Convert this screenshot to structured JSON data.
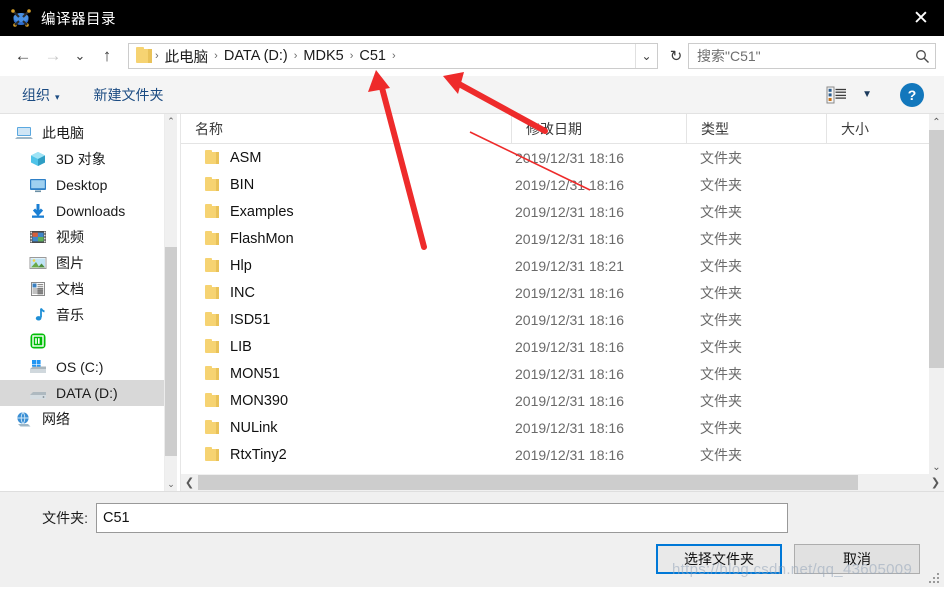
{
  "window": {
    "title": "编译器目录",
    "icon": "keil-uvision-icon",
    "close_label": "✕"
  },
  "nav": {
    "back_label": "←",
    "forward_label": "→",
    "recent_label": "⌄",
    "up_label": "↑",
    "breadcrumb": [
      "此电脑",
      "DATA (D:)",
      "MDK5",
      "C51"
    ],
    "breadcrumb_separator": "›",
    "breadcrumb_trailing_separator": "›",
    "dropdown_label": "⌄",
    "refresh_label": "↻",
    "search_placeholder": "搜索\"C51\"",
    "search_value": "",
    "search_icon": "🔍"
  },
  "commandbar": {
    "organize_label": "组织",
    "organize_caret": "▾",
    "new_folder_label": "新建文件夹",
    "view_caret": "▼",
    "help_label": "?"
  },
  "sidebar": {
    "items": [
      {
        "label": "此电脑",
        "icon": "this-pc-icon",
        "indent": false,
        "selected": false
      },
      {
        "label": "3D 对象",
        "icon": "3d-objects-icon",
        "indent": true,
        "selected": false
      },
      {
        "label": "Desktop",
        "icon": "desktop-icon",
        "indent": true,
        "selected": false
      },
      {
        "label": "Downloads",
        "icon": "downloads-icon",
        "indent": true,
        "selected": false
      },
      {
        "label": "视频",
        "icon": "videos-icon",
        "indent": true,
        "selected": false
      },
      {
        "label": "图片",
        "icon": "pictures-icon",
        "indent": true,
        "selected": false
      },
      {
        "label": "文档",
        "icon": "documents-icon",
        "indent": true,
        "selected": false
      },
      {
        "label": "音乐",
        "icon": "music-icon",
        "indent": true,
        "selected": false
      },
      {
        "label": "",
        "icon": "iqiyi-icon",
        "indent": true,
        "selected": false
      },
      {
        "label": "OS (C:)",
        "icon": "os-drive-icon",
        "indent": true,
        "selected": false
      },
      {
        "label": "DATA (D:)",
        "icon": "data-drive-icon",
        "indent": true,
        "selected": true
      },
      {
        "label": "网络",
        "icon": "network-icon",
        "indent": false,
        "selected": false
      }
    ],
    "scroll_up": "⌃",
    "scroll_down": "⌄"
  },
  "filelist": {
    "columns": [
      "名称",
      "修改日期",
      "类型",
      "大小"
    ],
    "sort_indicator": "⌃",
    "rows": [
      {
        "name": "ASM",
        "date": "2019/12/31 18:16",
        "type": "文件夹",
        "size": ""
      },
      {
        "name": "BIN",
        "date": "2019/12/31 18:16",
        "type": "文件夹",
        "size": ""
      },
      {
        "name": "Examples",
        "date": "2019/12/31 18:16",
        "type": "文件夹",
        "size": ""
      },
      {
        "name": "FlashMon",
        "date": "2019/12/31 18:16",
        "type": "文件夹",
        "size": ""
      },
      {
        "name": "Hlp",
        "date": "2019/12/31 18:21",
        "type": "文件夹",
        "size": ""
      },
      {
        "name": "INC",
        "date": "2019/12/31 18:16",
        "type": "文件夹",
        "size": ""
      },
      {
        "name": "ISD51",
        "date": "2019/12/31 18:16",
        "type": "文件夹",
        "size": ""
      },
      {
        "name": "LIB",
        "date": "2019/12/31 18:16",
        "type": "文件夹",
        "size": ""
      },
      {
        "name": "MON51",
        "date": "2019/12/31 18:16",
        "type": "文件夹",
        "size": ""
      },
      {
        "name": "MON390",
        "date": "2019/12/31 18:16",
        "type": "文件夹",
        "size": ""
      },
      {
        "name": "NULink",
        "date": "2019/12/31 18:16",
        "type": "文件夹",
        "size": ""
      },
      {
        "name": "RtxTiny2",
        "date": "2019/12/31 18:16",
        "type": "文件夹",
        "size": ""
      }
    ],
    "hscroll_left": "❮",
    "hscroll_right": "❯",
    "vscroll_up": "⌃",
    "vscroll_down": "⌄"
  },
  "footer": {
    "folder_label": "文件夹:",
    "folder_value": "C51",
    "select_button": "选择文件夹",
    "cancel_button": "取消"
  },
  "watermark": {
    "text": "https://blog.csdn.net/qq_43605009"
  },
  "annotations": {
    "arrow1_target": "MDK5",
    "arrow2_target": "C51",
    "color": "#ee2b2b"
  }
}
